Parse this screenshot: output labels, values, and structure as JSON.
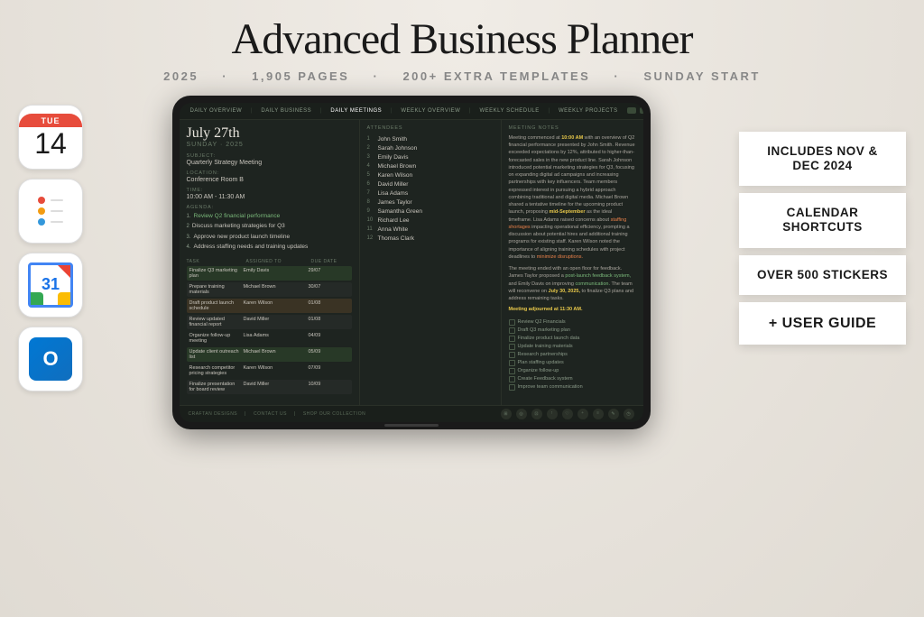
{
  "header": {
    "title": "Advanced Business Planner",
    "subtitle_year": "2025",
    "subtitle_pages": "1,905 PAGES",
    "subtitle_templates": "200+ EXTRA TEMPLATES",
    "subtitle_start": "SUNDAY START",
    "sep": "·"
  },
  "tablet": {
    "nav": {
      "items": [
        "DAILY OVERVIEW",
        "DAILY BUSINESS",
        "DAILY MEETINGS",
        "WEEKLY OVERVIEW",
        "WEEKLY SCHEDULE",
        "WEEKLY PROJECTS"
      ]
    },
    "date": "July 27th",
    "date_sub": "SUNDAY · 2025",
    "subject_label": "SUBJECT:",
    "subject_value": "Quarterly Strategy Meeting",
    "location_label": "LOCATION:",
    "location_value": "Conference Room B",
    "time_label": "TIME:",
    "time_value": "10:00 AM - 11:30 AM",
    "agenda_header": "AGENDA:",
    "agenda_items": [
      {
        "num": "1.",
        "text": "Review Q2 financial performance",
        "highlight": true
      },
      {
        "num": "2",
        "text": "Discuss marketing strategies for Q3"
      },
      {
        "num": "3.",
        "text": "Approve new product launch timeline",
        "highlight": false
      },
      {
        "num": "4.",
        "text": "Address staffing needs and training updates"
      }
    ],
    "tasks_header": "TASK",
    "tasks_col2": "ASSIGNED TO",
    "tasks_col3": "DUE DATE",
    "tasks": [
      {
        "task": "Finalize Q3 marketing plan",
        "assigned": "Emily Davis",
        "due": "29/07",
        "color": "green"
      },
      {
        "task": "Prepare training materials",
        "assigned": "Michael Brown",
        "due": "30/07"
      },
      {
        "task": "Draft product launch schedule",
        "assigned": "Karen Wilson",
        "due": "01/08",
        "color": "orange"
      },
      {
        "task": "Review updated financial report",
        "assigned": "David Miller",
        "due": "01/08"
      },
      {
        "task": "Organize follow-up meeting",
        "assigned": "Lisa Adams",
        "due": "04/09"
      },
      {
        "task": "Update client outreach list",
        "assigned": "Michael Brown",
        "due": "05/09",
        "color": "green"
      },
      {
        "task": "Research competitor pricing strategies",
        "assigned": "Karen Wilson",
        "due": "07/09"
      },
      {
        "task": "Finalize presentation for board review",
        "assigned": "David Miller",
        "due": "10/09"
      }
    ],
    "attendees_header": "ATTENDEES",
    "attendees": [
      "John Smith",
      "Sarah Johnson",
      "Emily Davis",
      "Michael Brown",
      "Karen Wilson",
      "David Miller",
      "Lisa Adams",
      "James Taylor",
      "Samantha Green",
      "Richard Lee",
      "Anna White",
      "Thomas Clark"
    ],
    "notes_header": "MEETING NOTES",
    "notes_p1": "Meeting commenced at 10:00 AM with an overview of Q2 financial performance presented by John Smith. Revenue exceeded expectations by 12%, attributed to higher-than-forecasted sales in the new product line. Sarah Johnson introduced potential marketing strategies for Q3, focusing on expanding digital ad campaigns and increasing partnerships with key influencers. Team members expressed interest in pursuing a hybrid approach combining traditional and digital media. Michael Brown shared a tentative timeline for the upcoming product launch, proposing mid-September as the ideal timeframe. Lisa Adams raised concerns about staffing shortages impacting operational efficiency, prompting a discussion about potential hires and additional training programs for existing staff. Karen Wilson noted the importance of aligning training schedules with project deadlines to minimize disruptions.",
    "notes_p2": "The meeting ended with an open floor for feedback. James Taylor proposed a post-launch feedback system, and Emily Davis on improving communication. The team will reconvene on July 30, 2025, to finalize Q3 plans and address remaining tasks.",
    "notes_footer": "Meeting adjourned at 11:30 AM.",
    "checklist": [
      "Review Q2 Financials",
      "Draft Q3 marketing plan",
      "Finalize product launch data",
      "Update training materials",
      "Research partnerships",
      "Plan staffing updates",
      "Organize follow-up",
      "Create Feedback system",
      "Improve team communication"
    ],
    "footer_links": [
      "CRAFTAN DESIGNS",
      "CONTACT US",
      "SHOP OUR COLLECTION"
    ]
  },
  "left_icons": {
    "calendar_day": "TUE",
    "calendar_num": "14",
    "gcal_num": "31"
  },
  "right_badges": [
    {
      "id": "nov-dec",
      "text": "INCLUDES NOV & DEC 2024"
    },
    {
      "id": "cal-shortcuts",
      "text": "CALENDAR SHORTCUTS"
    },
    {
      "id": "stickers",
      "text": "OVER 500 STICKERS"
    },
    {
      "id": "user-guide",
      "text": "+ USER GUIDE"
    }
  ]
}
